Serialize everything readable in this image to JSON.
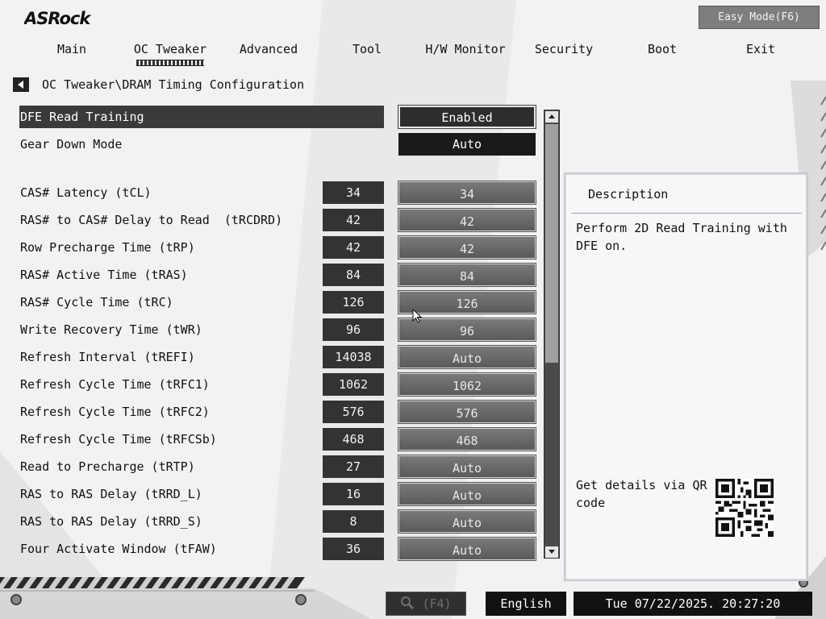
{
  "brand": {
    "logo_text": "ASRock"
  },
  "header": {
    "easy_mode_label": "Easy Mode(F6)"
  },
  "tabs": [
    {
      "label": "Main"
    },
    {
      "label": "OC Tweaker",
      "active": true
    },
    {
      "label": "Advanced"
    },
    {
      "label": "Tool"
    },
    {
      "label": "H/W Monitor"
    },
    {
      "label": "Security"
    },
    {
      "label": "Boot"
    },
    {
      "label": "Exit"
    }
  ],
  "breadcrumb": "OC Tweaker\\DRAM Timing Configuration",
  "settings": [
    {
      "label": "DFE Read Training",
      "current": "",
      "value": "Enabled"
    },
    {
      "label": "Gear Down Mode",
      "current": "",
      "value": "Auto"
    },
    {
      "label": "CAS# Latency (tCL)",
      "current": "34",
      "value": "34"
    },
    {
      "label": "RAS# to CAS# Delay to Read  (tRCDRD)",
      "current": "42",
      "value": "42"
    },
    {
      "label": "Row Precharge Time (tRP)",
      "current": "42",
      "value": "42"
    },
    {
      "label": "RAS# Active Time (tRAS)",
      "current": "84",
      "value": "84"
    },
    {
      "label": "RAS# Cycle Time (tRC)",
      "current": "126",
      "value": "126"
    },
    {
      "label": "Write Recovery Time (tWR)",
      "current": "96",
      "value": "96"
    },
    {
      "label": "Refresh Interval (tREFI)",
      "current": "14038",
      "value": "Auto"
    },
    {
      "label": "Refresh Cycle Time (tRFC1)",
      "current": "1062",
      "value": "1062"
    },
    {
      "label": "Refresh Cycle Time (tRFC2)",
      "current": "576",
      "value": "576"
    },
    {
      "label": "Refresh Cycle Time (tRFCSb)",
      "current": "468",
      "value": "468"
    },
    {
      "label": "Read to Precharge (tRTP)",
      "current": "27",
      "value": "Auto"
    },
    {
      "label": "RAS to RAS Delay (tRRD_L)",
      "current": "16",
      "value": "Auto"
    },
    {
      "label": "RAS to RAS Delay (tRRD_S)",
      "current": "8",
      "value": "Auto"
    },
    {
      "label": "Four Activate Window (tFAW)",
      "current": "36",
      "value": "Auto"
    }
  ],
  "description": {
    "title": "Description",
    "text": "Perform 2D Read Training with DFE on.",
    "qr_text": "Get details via QR code"
  },
  "footer": {
    "search_label": "(F4)",
    "language": "English",
    "datetime": "Tue 07/22/2025. 20:27:20"
  },
  "colors": {
    "background": "#f2f2f2",
    "highlight_row": "#3a3a3a",
    "value_box": "#333333",
    "option_box": "#6a6a6a"
  }
}
